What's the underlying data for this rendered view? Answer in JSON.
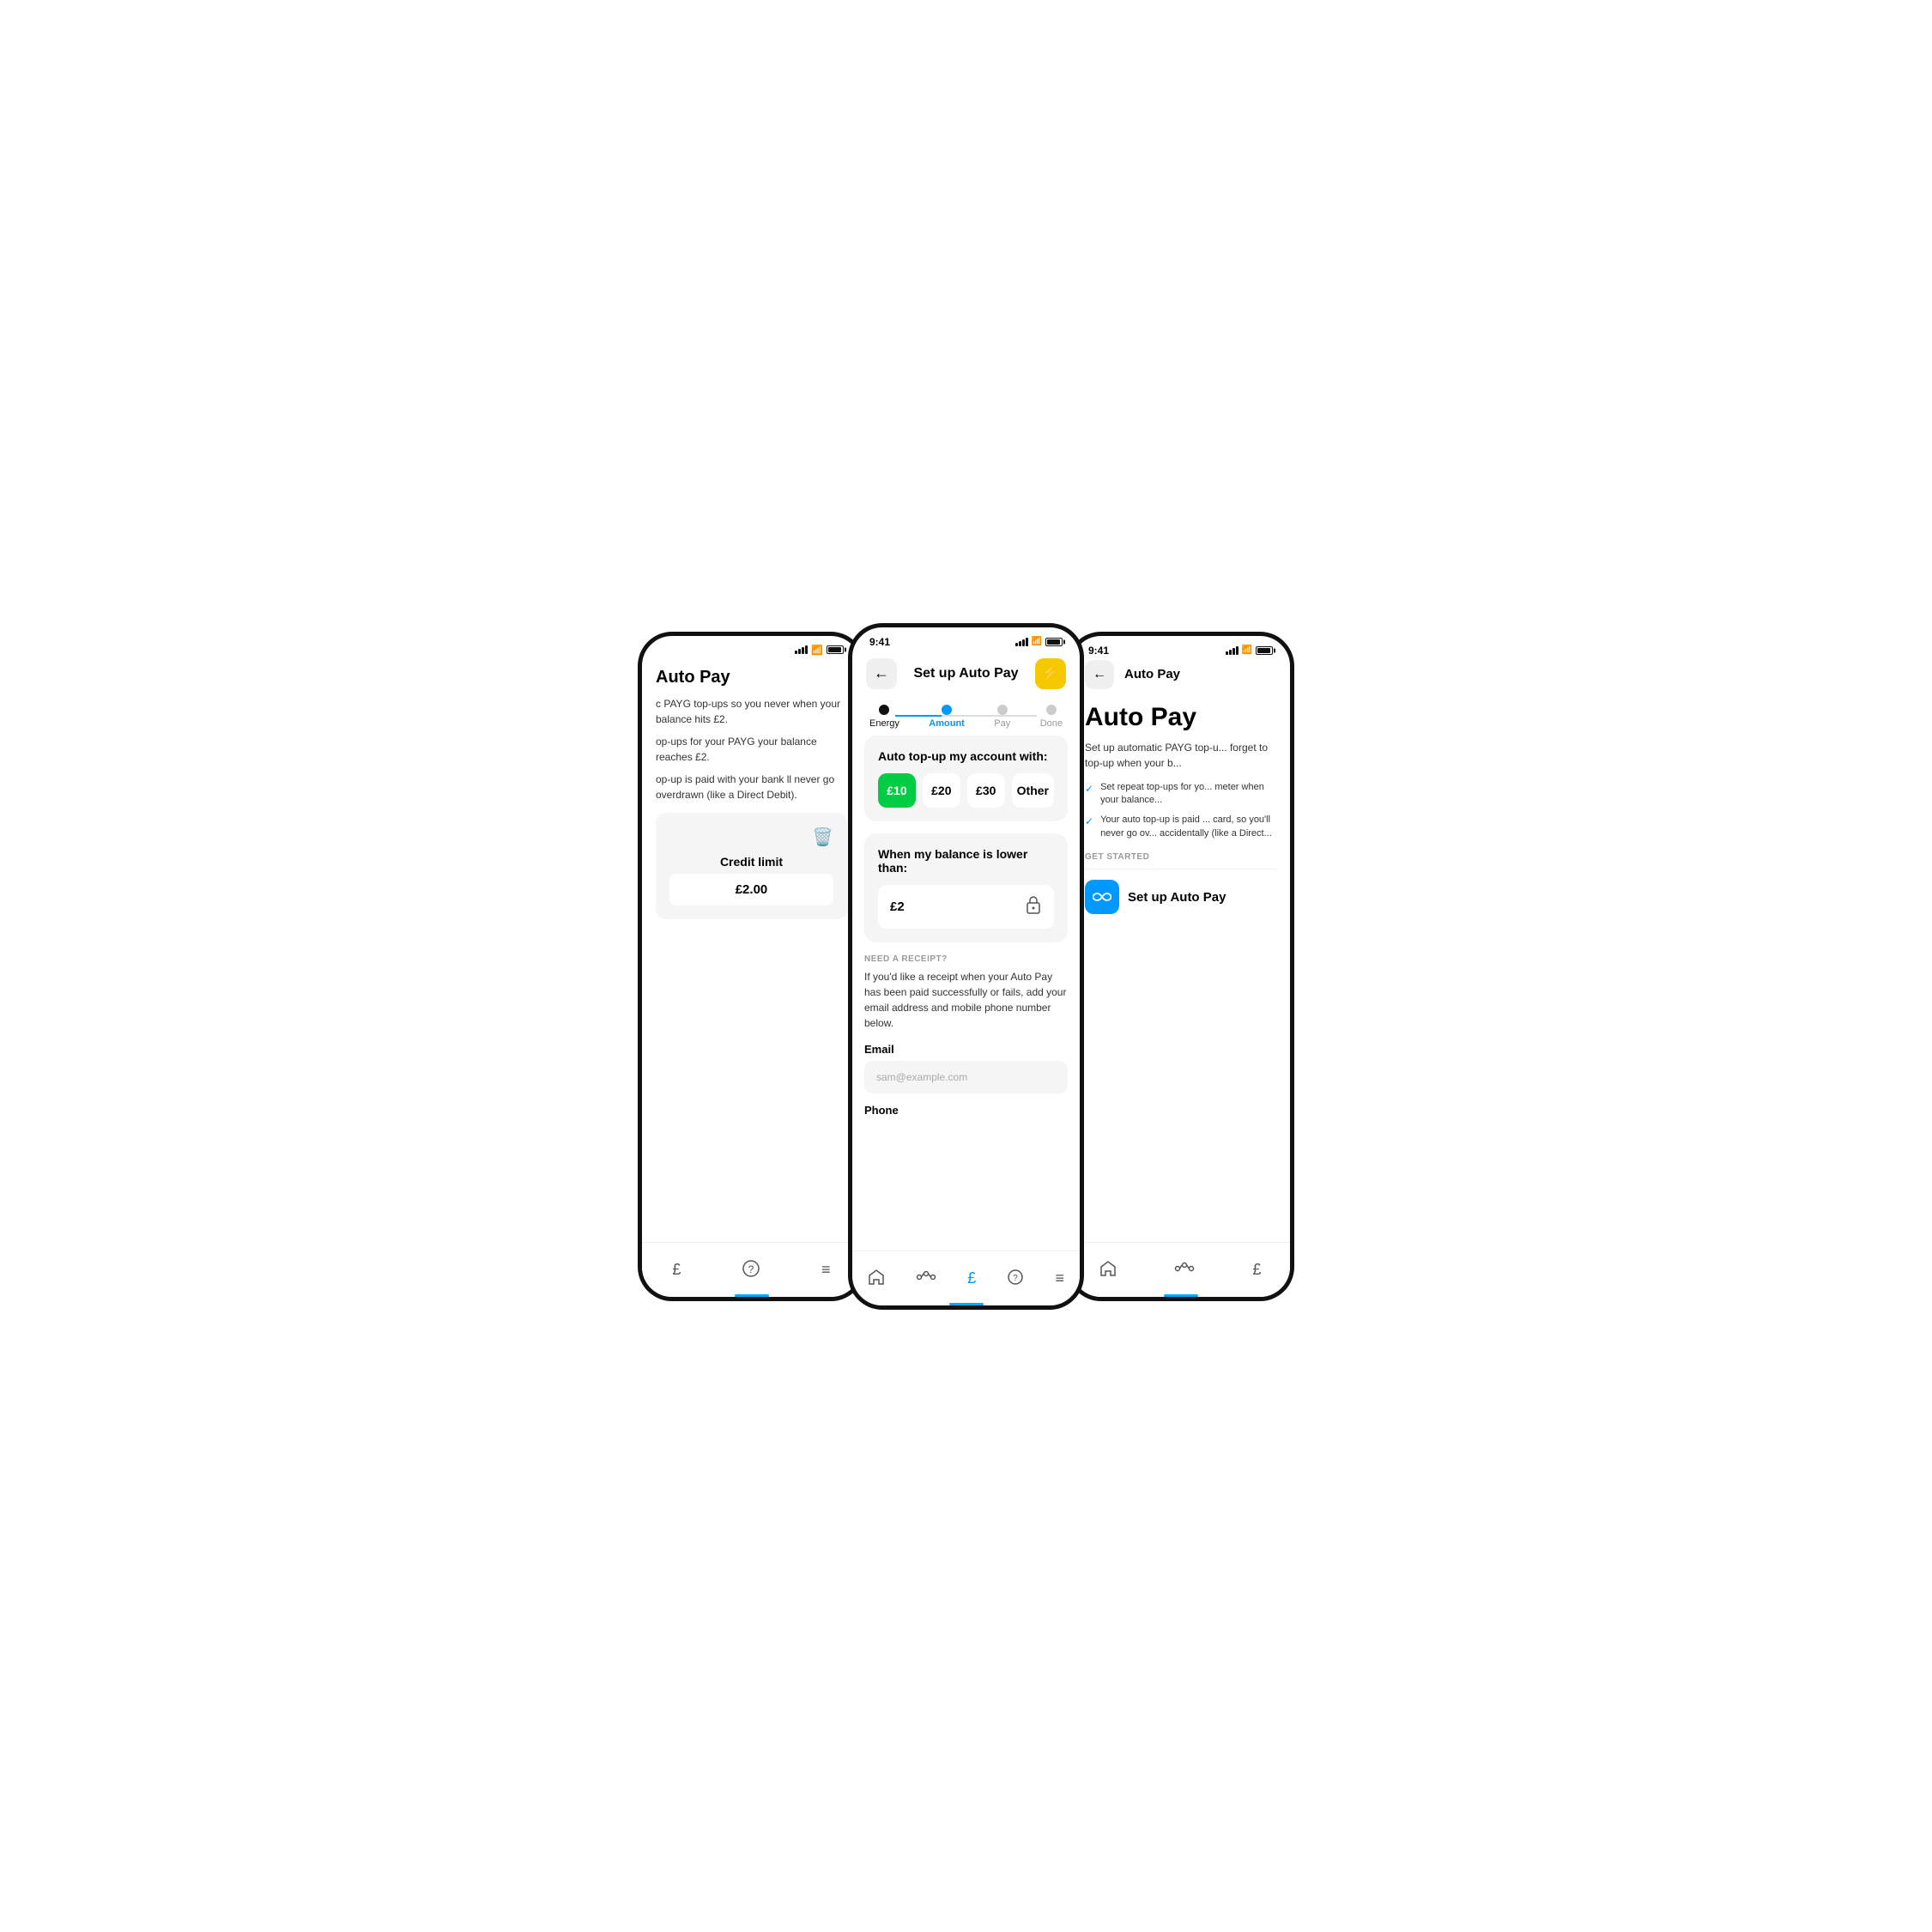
{
  "colors": {
    "accent_blue": "#0099ff",
    "accent_green": "#00cc44",
    "accent_yellow": "#f5c800",
    "bg_light": "#f5f5f5",
    "text_dark": "#111",
    "text_muted": "#999"
  },
  "left_phone": {
    "status_time": "",
    "title": "Auto Pay",
    "body1": "c PAYG top-ups so you never when your balance hits £2.",
    "body2": "op-ups for your PAYG your balance reaches £2.",
    "body3": "op-up is paid with your bank ll never go overdrawn (like a Direct Debit).",
    "card": {
      "credit_label": "Credit limit",
      "credit_value": "£2.00"
    },
    "nav_items": [
      "£",
      "?",
      "≡"
    ]
  },
  "center_phone": {
    "status_time": "9:41",
    "header": {
      "back_label": "←",
      "title": "Set up Auto Pay",
      "icon": "⚡"
    },
    "steps": [
      {
        "label": "Energy",
        "state": "done"
      },
      {
        "label": "Amount",
        "state": "active"
      },
      {
        "label": "Pay",
        "state": "default"
      },
      {
        "label": "Done",
        "state": "default"
      }
    ],
    "topup_card": {
      "title": "Auto top-up my account with:",
      "amounts": [
        {
          "value": "£10",
          "selected": true
        },
        {
          "value": "£20",
          "selected": false
        },
        {
          "value": "£30",
          "selected": false
        },
        {
          "value": "Other",
          "selected": false
        }
      ]
    },
    "balance_card": {
      "title": "When my balance is lower than:",
      "value": "£2"
    },
    "receipt": {
      "section_label": "NEED A RECEIPT?",
      "body": "If you'd like a receipt when your Auto Pay has been paid successfully or fails, add your email address and mobile phone number below.",
      "email_label": "Email",
      "email_placeholder": "sam@example.com",
      "phone_label": "Phone"
    },
    "nav_items": [
      "🏠",
      "⬡⬡",
      "£",
      "?",
      "≡"
    ]
  },
  "right_phone": {
    "status_time": "9:41",
    "header": {
      "back_label": "←",
      "title": "Auto Pay"
    },
    "heading": "Auto Pay",
    "description": "Set up automatic PAYG top-u... forget to top-up when your b...",
    "checks": [
      "Set repeat top-ups for yo... meter when your balance...",
      "Your auto top-up is paid ... card, so you'll never go ov... accidentally (like a Direct..."
    ],
    "get_started_label": "GET STARTED",
    "setup_button_label": "Set up Auto Pay",
    "nav_items": [
      "🏠",
      "⬡⬡",
      "£"
    ]
  }
}
